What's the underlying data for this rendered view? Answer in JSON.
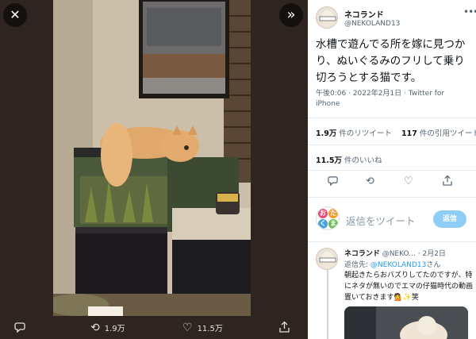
{
  "viewer": {
    "close_icon": "close-icon",
    "expand_icon": "expand-icon",
    "actions": {
      "reply_icon": "reply-icon",
      "retweet_count": "1.9万",
      "like_count": "11.5万",
      "share_icon": "share-icon"
    }
  },
  "tweet": {
    "author_name": "ネコランド",
    "author_handle": "@NEKOLAND13",
    "text": "水槽で遊んでる所を嫁に見つかり、ぬいぐるみのフリして乗り切ろうとする猫です。",
    "meta": "午後0:06 · 2022年2月1日 · Twitter for iPhone",
    "retweets_value": "1.9万",
    "retweets_label": "件のリツイート",
    "quotes_value": "117",
    "quotes_label": "件の引用ツイート",
    "likes_value": "11.5万",
    "likes_label": "件のいいね"
  },
  "reply_box": {
    "avatar_chars": [
      "お",
      "た",
      "く",
      "ま"
    ],
    "placeholder": "返信をツイート",
    "button_label": "返信"
  },
  "reply": {
    "author_name": "ネコランド",
    "author_handle": "@NEKO...",
    "date": "2月2日",
    "reply_to_prefix": "返信先:",
    "reply_to_handle": "@NEKOLAND13",
    "reply_to_suffix": "さん",
    "text": "朝起きたらおバズりしてたのですが、特にネタが無いのでエマの仔猫時代の動画置いておきます💁✨笑"
  },
  "colors": {
    "accent": "#1d9bf0",
    "reply_button": "#8ecdf8",
    "viewer_bg": "#2e2520"
  }
}
